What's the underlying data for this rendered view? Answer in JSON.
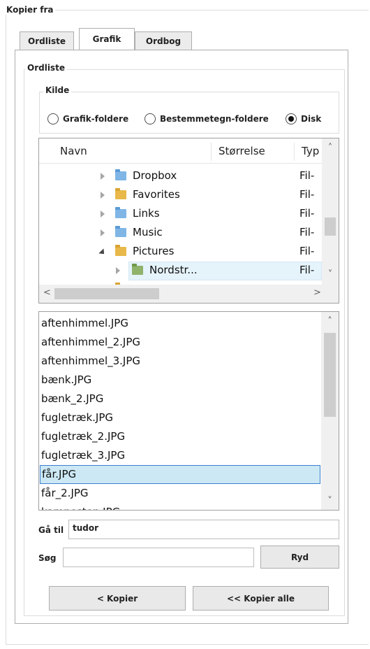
{
  "outer_group": {
    "title": "Kopier fra"
  },
  "tabs": [
    {
      "label": "Ordliste",
      "active": false
    },
    {
      "label": "Grafik",
      "active": true
    },
    {
      "label": "Ordbog",
      "active": false
    }
  ],
  "ordliste_group": {
    "title": "Ordliste"
  },
  "kilde_group": {
    "title": "Kilde",
    "options": [
      {
        "label": "Grafik-foldere",
        "checked": false
      },
      {
        "label": "Bestemmetegn-foldere",
        "checked": false
      },
      {
        "label": "Disk",
        "checked": true
      }
    ]
  },
  "tree": {
    "columns": [
      "Navn",
      "Størrelse",
      "Typ"
    ],
    "rows": [
      {
        "name": "Dropbox",
        "type": "Fil-",
        "icon": "dropbox-folder-icon",
        "expanded": false
      },
      {
        "name": "Favorites",
        "type": "Fil-",
        "icon": "favorites-folder-icon",
        "expanded": false
      },
      {
        "name": "Links",
        "type": "Fil-",
        "icon": "links-folder-icon",
        "expanded": false
      },
      {
        "name": "Music",
        "type": "Fil-",
        "icon": "music-folder-icon",
        "expanded": false
      },
      {
        "name": "Pictures",
        "type": "Fil-",
        "icon": "pictures-folder-icon",
        "expanded": true
      },
      {
        "name": "Nordstr...",
        "type": "Fil-",
        "icon": "folder-icon",
        "expanded": false,
        "selected": true
      }
    ]
  },
  "files": [
    "aftenhimmel.JPG",
    "aftenhimmel_2.JPG",
    "aftenhimmel_3.JPG",
    "bænk.JPG",
    "bænk_2.JPG",
    "fugletræk.JPG",
    "fugletræk_2.JPG",
    "fugletræk_3.JPG",
    "får.JPG",
    "får_2.JPG",
    "kampesten.JPG"
  ],
  "selected_file": "får.JPG",
  "goto": {
    "label": "Gå til",
    "value": "tudor"
  },
  "search": {
    "label": "Søg",
    "value": "",
    "clear_label": "Ryd"
  },
  "actions": {
    "copy_label": "< Kopier",
    "copy_all_label": "<< Kopier alle"
  },
  "colors": {
    "selection": "#cce8f4",
    "selection_border": "#3b7fd0",
    "border": "#adadad"
  }
}
